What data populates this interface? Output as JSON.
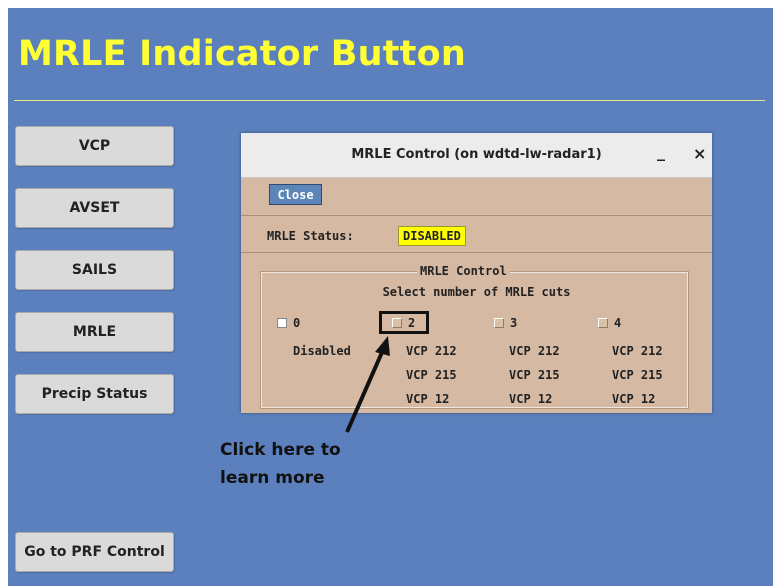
{
  "slide_title": "MRLE Indicator Button",
  "nav": [
    {
      "label": "VCP"
    },
    {
      "label": "AVSET"
    },
    {
      "label": "SAILS"
    },
    {
      "label": "MRLE"
    },
    {
      "label": "Precip Status"
    }
  ],
  "bottom_button": {
    "label": "Go to PRF Control"
  },
  "dialog": {
    "title": "MRLE Control (on wdtd-lw-radar1)",
    "minimize": "_",
    "close_x": "×",
    "close_button": "Close",
    "status_label": "MRLE Status:",
    "status_value": "DISABLED",
    "group_label": "MRLE Control",
    "group_subtitle": "Select number of MRLE cuts",
    "options": [
      {
        "label": "0",
        "lines": [
          "Disabled"
        ]
      },
      {
        "label": "2",
        "lines": [
          "VCP 212",
          "VCP 215",
          "VCP 12"
        ]
      },
      {
        "label": "3",
        "lines": [
          "VCP 212",
          "VCP 215",
          "VCP 12"
        ]
      },
      {
        "label": "4",
        "lines": [
          "VCP 212",
          "VCP 215",
          "VCP 12"
        ]
      }
    ]
  },
  "callout": {
    "line1": "Click here to",
    "line2": "learn more"
  }
}
